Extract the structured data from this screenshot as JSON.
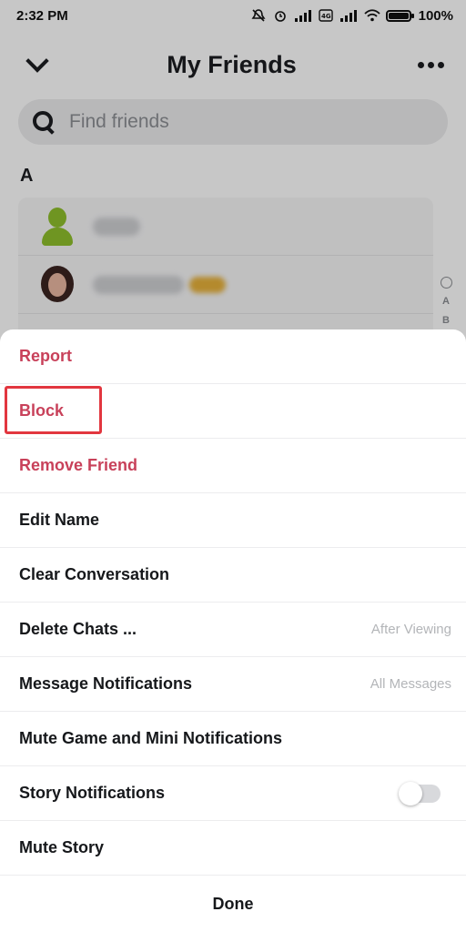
{
  "status_bar": {
    "time": "2:32 PM",
    "battery": "100%",
    "icons": [
      "mute-icon",
      "alarm-icon",
      "signal-icon",
      "volte-icon",
      "signal-icon",
      "wifi-icon",
      "battery-icon"
    ]
  },
  "header": {
    "title": "My Friends",
    "back_icon": "chevron-down-icon",
    "more_icon": "more-horizontal-icon"
  },
  "search": {
    "placeholder": "Find friends",
    "icon": "search-icon"
  },
  "friends": {
    "section_letter": "A",
    "index_letters": [
      "A",
      "B"
    ]
  },
  "sheet": {
    "items": [
      {
        "label": "Report",
        "style": "danger"
      },
      {
        "label": "Block",
        "style": "danger",
        "highlighted": true
      },
      {
        "label": "Remove Friend",
        "style": "danger"
      },
      {
        "label": "Edit Name"
      },
      {
        "label": "Clear Conversation"
      },
      {
        "label": "Delete Chats ...",
        "value": "After Viewing"
      },
      {
        "label": "Message Notifications",
        "value": "All Messages"
      },
      {
        "label": "Mute Game and Mini Notifications"
      },
      {
        "label": "Story Notifications",
        "toggle": false
      },
      {
        "label": "Mute Story"
      }
    ],
    "done_label": "Done"
  },
  "colors": {
    "danger": "#c8415a",
    "highlight": "#e2363f",
    "text": "#16181b"
  }
}
